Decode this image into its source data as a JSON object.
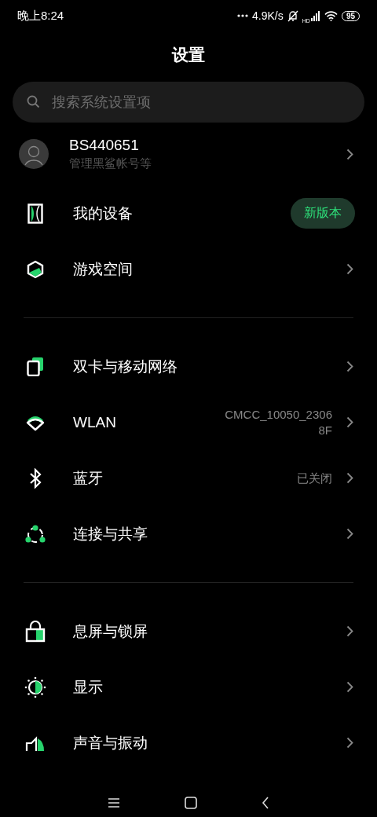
{
  "status_bar": {
    "time": "晚上8:24",
    "speed": "4.9K/s",
    "network_label": "HD",
    "battery": "95"
  },
  "header": {
    "title": "设置"
  },
  "search": {
    "placeholder": "搜索系统设置项"
  },
  "sections": [
    {
      "items": [
        {
          "kind": "account",
          "title": "BS440651",
          "subtitle": "管理黑鲨帐号等"
        },
        {
          "kind": "device",
          "title": "我的设备",
          "badge": "新版本"
        },
        {
          "kind": "game",
          "title": "游戏空间"
        }
      ]
    },
    {
      "items": [
        {
          "kind": "sim",
          "title": "双卡与移动网络"
        },
        {
          "kind": "wifi",
          "title": "WLAN",
          "value": "CMCC_10050_2306\n8F"
        },
        {
          "kind": "bluetooth",
          "title": "蓝牙",
          "value": "已关闭"
        },
        {
          "kind": "share",
          "title": "连接与共享"
        }
      ]
    },
    {
      "items": [
        {
          "kind": "lock",
          "title": "息屏与锁屏"
        },
        {
          "kind": "display",
          "title": "显示"
        },
        {
          "kind": "sound",
          "title": "声音与振动"
        }
      ]
    }
  ]
}
